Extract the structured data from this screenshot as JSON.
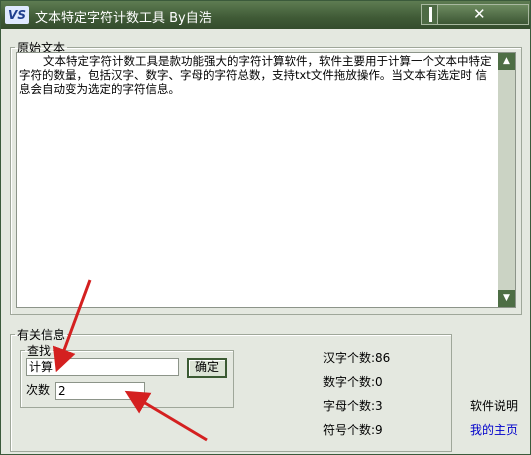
{
  "window": {
    "logo": "VS",
    "title": "文本特定字符计数工具  By自浩"
  },
  "source_text": {
    "legend": "原始文本",
    "content": "文本特定字符计数工具是款功能强大的字符计算软件，软件主要用于计算一个文本中特定字符的数量，包括汉字、数字、字母的字符总数，支持txt文件拖放操作。当文本有选定时 信息会自动变为选定的字符信息。"
  },
  "info": {
    "legend": "有关信息",
    "search_legend": "查找",
    "search_value": "计算",
    "confirm_label": "确定",
    "count_label": "次数",
    "count_value": "2"
  },
  "stats": [
    {
      "label": "汉字个数:86"
    },
    {
      "label": "数字个数:0"
    },
    {
      "label": "字母个数:3"
    },
    {
      "label": "符号个数:9"
    }
  ],
  "links": {
    "help": "软件说明",
    "homepage": "我的主页"
  },
  "colors": {
    "titlebar": "#3f5a36",
    "accent": "#4e6e45",
    "annotation_arrow": "#d42020",
    "link": "#0000cc"
  },
  "icons": {
    "scroll_up": "▲",
    "scroll_down": "▼",
    "close": "✕"
  }
}
